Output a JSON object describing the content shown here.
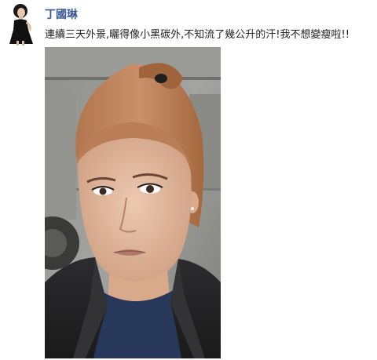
{
  "post": {
    "author_name": "丁國琳",
    "message": "連續三天外景,曬得像小黑碳外,不知流了幾公升的汗!我不想變瘦啦!!",
    "avatar_icon": "profile-photo",
    "photo_icon": "selfie-photo"
  },
  "colors": {
    "author_link": "#3b5998",
    "message_text": "#222222",
    "background": "#ffffff"
  }
}
